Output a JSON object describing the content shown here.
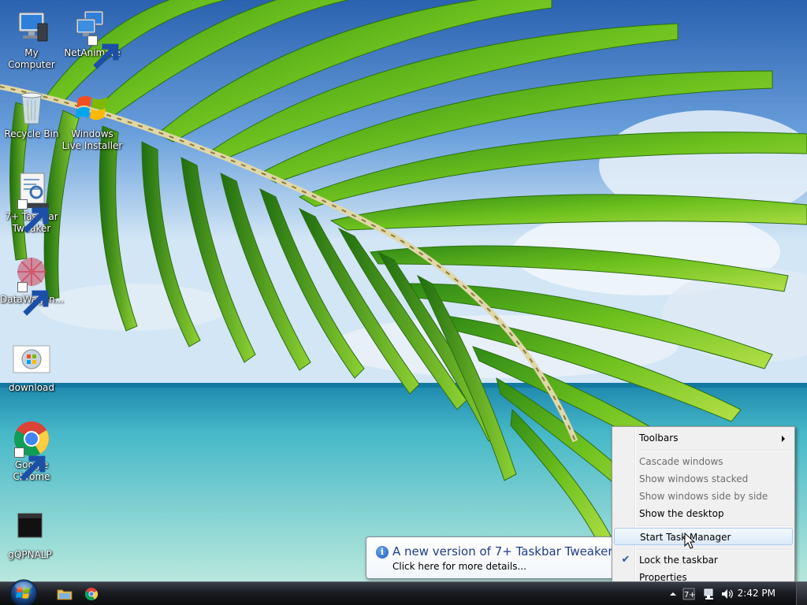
{
  "desktop_icons": [
    {
      "label": "My Computer",
      "icon": "computer-icon",
      "shortcut": false
    },
    {
      "label": "NetAnimate",
      "icon": "network-icon",
      "shortcut": true
    },
    {
      "label": "Recycle Bin",
      "icon": "recycle-bin-icon",
      "shortcut": false
    },
    {
      "label": "Windows Live Installer",
      "icon": "windows-flag-icon",
      "shortcut": false
    },
    {
      "label": "7+ Taskbar Tweaker",
      "icon": "tweaker-icon",
      "shortcut": true
    },
    {
      "label": "DataWagon...",
      "icon": "datawagon-icon",
      "shortcut": true
    },
    {
      "label": "download",
      "icon": "windows-orb-icon",
      "shortcut": false
    },
    {
      "label": "Google Chrome",
      "icon": "chrome-icon",
      "shortcut": true
    },
    {
      "label": "gQPNALP",
      "icon": "black-square-icon",
      "shortcut": false
    }
  ],
  "balloon": {
    "title": "A new version of 7+ Taskbar Tweaker is",
    "body": "Click here for more details...",
    "icon": "info-icon"
  },
  "context_menu": {
    "items": [
      {
        "label": "Toolbars",
        "enabled": true,
        "submenu": true
      },
      {
        "label": "Cascade windows",
        "enabled": false
      },
      {
        "label": "Show windows stacked",
        "enabled": false
      },
      {
        "label": "Show windows side by side",
        "enabled": false
      },
      {
        "label": "Show the desktop",
        "enabled": true
      },
      {
        "label": "Start Task Manager",
        "enabled": true,
        "highlighted": true
      },
      {
        "label": "Lock the taskbar",
        "enabled": true,
        "checked": true
      },
      {
        "label": "Properties",
        "enabled": true
      }
    ]
  },
  "taskbar": {
    "start_button": "windows-orb-icon",
    "quick_launch": [
      "explorer-folder-icon",
      "chrome-icon"
    ],
    "tray_icons": [
      "show-hidden-arrow-icon",
      "taskbar-tweaker-icon",
      "network-icon",
      "volume-icon"
    ],
    "clock": "2:42 PM"
  },
  "colors": {
    "balloon_title": "#1e3e8a",
    "menu_bg": "#f0f0f0",
    "menu_highlight": "#dbeaf9",
    "disabled_text": "#6d6d6d"
  }
}
